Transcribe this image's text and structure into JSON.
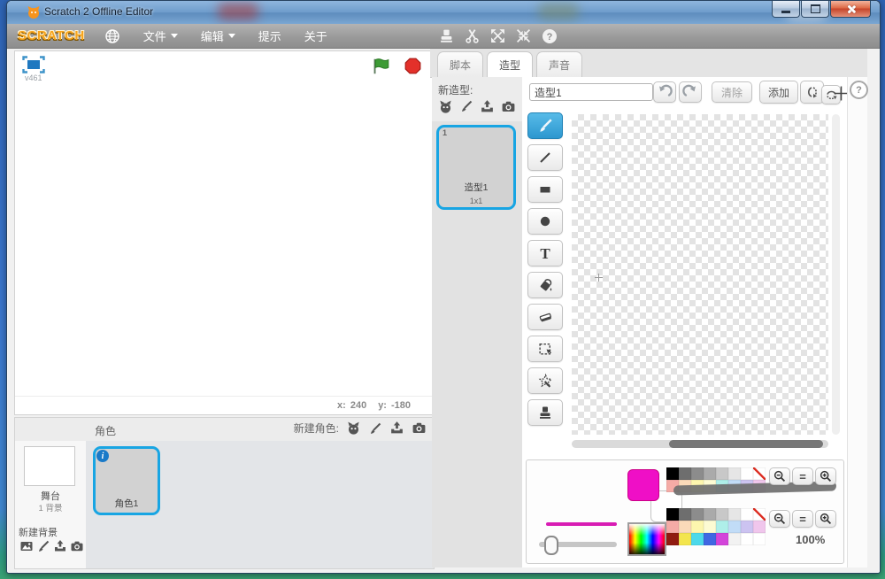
{
  "window": {
    "title": "Scratch 2 Offline Editor"
  },
  "menu_bar": {
    "logo": "SCRATCH",
    "items": [
      {
        "label": "文件",
        "has_dropdown": true
      },
      {
        "label": "编辑",
        "has_dropdown": true
      },
      {
        "label": "提示",
        "has_dropdown": false
      },
      {
        "label": "关于",
        "has_dropdown": false
      }
    ],
    "toolbar_icons": [
      "duplicate-stamp",
      "delete-scissors",
      "grow",
      "shrink",
      "block-help"
    ]
  },
  "stage": {
    "version": "v461",
    "coords": {
      "x_label": "x:",
      "x_value": "240",
      "y_label": "y:",
      "y_value": "-180"
    }
  },
  "sprites_panel": {
    "title": "角色",
    "new_sprite_label": "新建角色:",
    "new_sprite_icons": [
      "sprite-library",
      "paintbrush",
      "upload",
      "camera"
    ],
    "stage_thumbnail": {
      "name": "舞台",
      "backdrops": "1 背景"
    },
    "new_backdrop_label": "新建背景",
    "new_backdrop_icons": [
      "backdrop-library",
      "paintbrush",
      "upload",
      "camera"
    ],
    "sprites": [
      {
        "name": "角色1",
        "info_glyph": "i"
      }
    ]
  },
  "tabs": [
    {
      "label": "脚本",
      "active": false
    },
    {
      "label": "造型",
      "active": true
    },
    {
      "label": "声音",
      "active": false
    }
  ],
  "costumes_panel": {
    "new_costume_label": "新造型:",
    "new_costume_icons": [
      "costume-library",
      "paintbrush",
      "upload",
      "camera"
    ],
    "costumes": [
      {
        "index": "1",
        "name": "造型1",
        "size": "1x1"
      }
    ]
  },
  "paint_editor": {
    "costume_name_value": "造型1",
    "clear_label": "清除",
    "add_label": "添加",
    "text_tool_glyph": "T",
    "zoom_reset_label": "=",
    "zoom_level": "100%",
    "help_label": "?",
    "tools": [
      "brush",
      "line",
      "rectangle",
      "ellipse",
      "text",
      "fill",
      "eraser",
      "select",
      "magic-wand",
      "stamp"
    ],
    "selected_tool": "brush",
    "colors": {
      "foreground": "#ef0fc6",
      "background": "#ffffff",
      "stroke_preview": "#d81cb4",
      "selection_blue": "#18a5e3",
      "palette_grays": [
        "#000000",
        "#6e6e6e",
        "#8c8c8c",
        "#aaaaaa",
        "#c8c8c8",
        "#e6e6e6",
        "#ffffff",
        "transparent"
      ],
      "palette_pastels": [
        "#f5aba6",
        "#fbdab9",
        "#fdf6ae",
        "#fdfbd3",
        "#aeefe9",
        "#c1dcf7",
        "#ccc3f1",
        "#f0c6ec"
      ],
      "palette_bright": [
        "#901b10",
        "#f3e54d",
        "#4dd9ea",
        "#4067e2",
        "#d344da",
        "#f2f2f2",
        "#ffffff",
        "#ffffff"
      ]
    }
  }
}
